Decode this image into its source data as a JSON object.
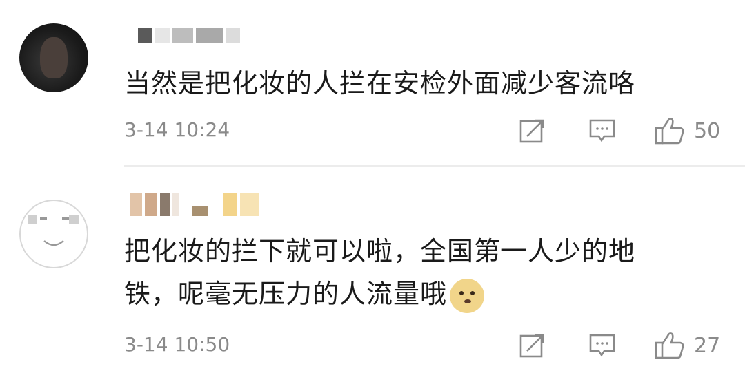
{
  "comments": [
    {
      "text": "当然是把化妆的人拦在安检外面减少客流咯",
      "time": "3-14 10:24",
      "likes": "50",
      "avatar_icon": "person-photo-avatar",
      "username_blur_colors": [
        "#555555",
        "#b5b5b5",
        "#c7c7c7",
        "#9a9a9a"
      ]
    },
    {
      "text_line1": "把化妆的拦下就可以啦，全国第一人少的地",
      "text_line2": "铁，呢毫无压力的人流量哦",
      "emoji": "doge-emoji",
      "time": "3-14 10:50",
      "likes": "27",
      "avatar_icon": "smiley-face-avatar",
      "username_blur_colors": [
        "#e2c4a8",
        "#cfa98a",
        "#7d6a5c",
        "#c2a780",
        "#f3d48a",
        "#f7e3b4"
      ]
    }
  ],
  "icons": {
    "share": "share-icon",
    "reply": "reply-icon",
    "like": "thumbs-up-icon"
  }
}
